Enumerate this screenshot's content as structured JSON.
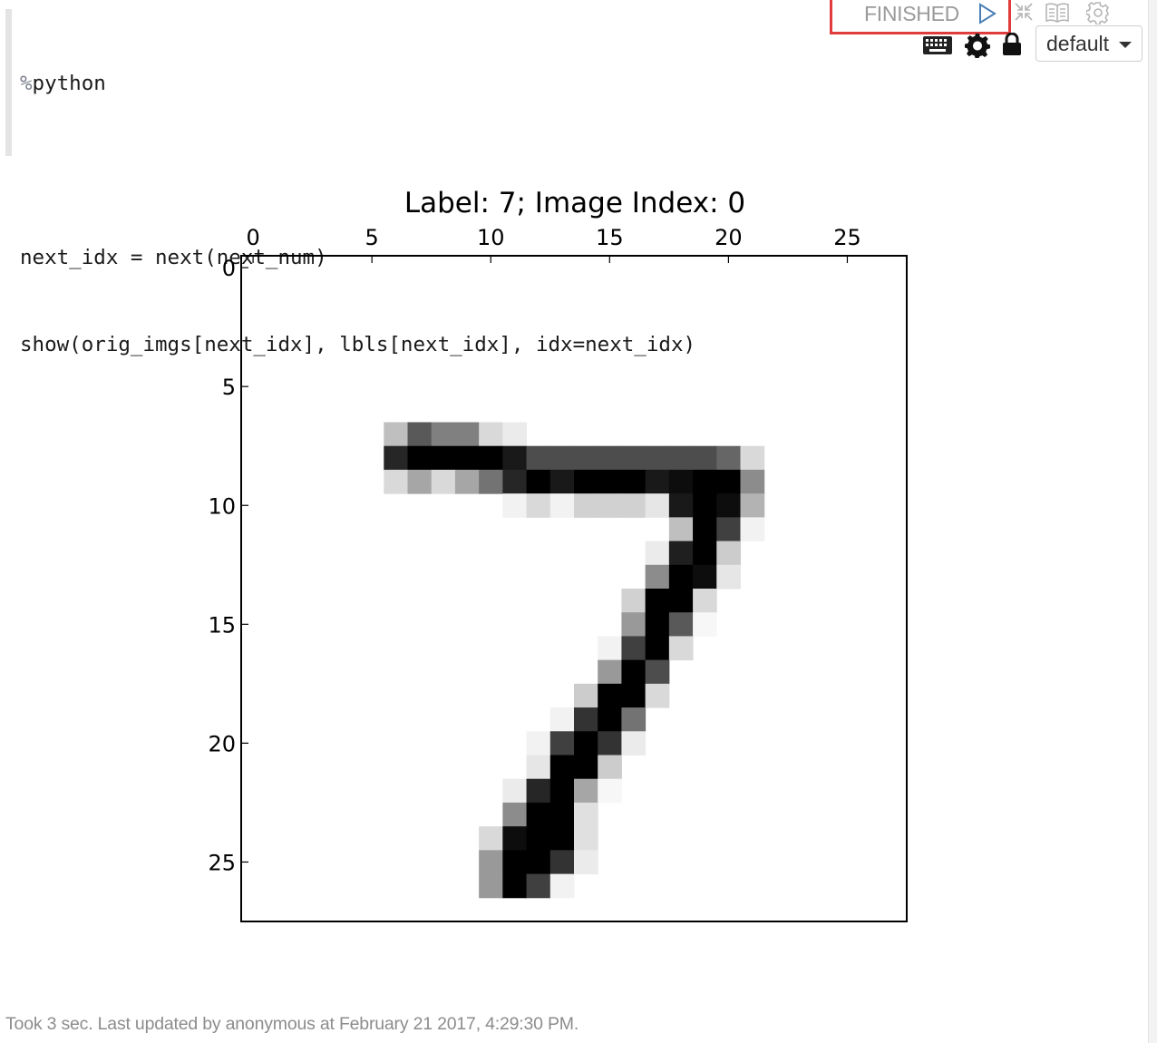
{
  "paragraph": {
    "status": "FINISHED",
    "interpreter_dropdown": "default",
    "code_lines": [
      {
        "prefix": "%",
        "rest": "python"
      },
      {
        "prefix": "",
        "rest": ""
      },
      {
        "prefix": "",
        "rest": "next_idx = next(next_num)"
      },
      {
        "prefix": "",
        "rest": "show(orig_imgs[next_idx], lbls[next_idx], idx=next_idx)"
      }
    ],
    "footer": "Took 3 sec. Last updated by anonymous at February 21 2017, 4:29:30 PM.",
    "icons": {
      "run": "play-outline-icon",
      "collapse": "collapse-arrows-icon",
      "book": "book-icon",
      "settings": "gear-outline-icon",
      "keyboard": "keyboard-icon",
      "paragraph_settings": "gear-solid-icon",
      "lock": "lock-icon"
    },
    "colors": {
      "status_highlight": "#e03c3c",
      "status_text": "#9a9a9a"
    }
  },
  "chart_data": {
    "type": "heatmap",
    "title": "Label: 7; Image Index: 0",
    "colormap": "gray_r",
    "xlim": [
      -0.5,
      27.5
    ],
    "ylim": [
      27.5,
      -0.5
    ],
    "xticks": [
      0,
      5,
      10,
      15,
      20,
      25
    ],
    "yticks": [
      0,
      5,
      10,
      15,
      20,
      25
    ],
    "xaxis_position": "top",
    "grid": false,
    "pixels": [
      [
        7,
        6,
        0.25
      ],
      [
        7,
        7,
        0.65
      ],
      [
        7,
        8,
        0.5
      ],
      [
        7,
        9,
        0.5
      ],
      [
        7,
        10,
        0.15
      ],
      [
        7,
        11,
        0.08
      ],
      [
        8,
        6,
        0.85
      ],
      [
        8,
        7,
        1.0
      ],
      [
        8,
        8,
        1.0
      ],
      [
        8,
        9,
        1.0
      ],
      [
        8,
        10,
        1.0
      ],
      [
        8,
        11,
        0.9
      ],
      [
        8,
        12,
        0.7
      ],
      [
        8,
        13,
        0.7
      ],
      [
        8,
        14,
        0.7
      ],
      [
        8,
        15,
        0.7
      ],
      [
        8,
        16,
        0.7
      ],
      [
        8,
        17,
        0.7
      ],
      [
        8,
        18,
        0.7
      ],
      [
        8,
        19,
        0.7
      ],
      [
        8,
        20,
        0.6
      ],
      [
        8,
        21,
        0.15
      ],
      [
        9,
        6,
        0.15
      ],
      [
        9,
        7,
        0.35
      ],
      [
        9,
        8,
        0.15
      ],
      [
        9,
        9,
        0.35
      ],
      [
        9,
        10,
        0.55
      ],
      [
        9,
        11,
        0.85
      ],
      [
        9,
        12,
        1.0
      ],
      [
        9,
        13,
        0.9
      ],
      [
        9,
        14,
        1.0
      ],
      [
        9,
        15,
        1.0
      ],
      [
        9,
        16,
        1.0
      ],
      [
        9,
        17,
        0.9
      ],
      [
        9,
        18,
        0.95
      ],
      [
        9,
        19,
        1.0
      ],
      [
        9,
        20,
        1.0
      ],
      [
        9,
        21,
        0.45
      ],
      [
        10,
        11,
        0.05
      ],
      [
        10,
        12,
        0.15
      ],
      [
        10,
        13,
        0.05
      ],
      [
        10,
        14,
        0.18
      ],
      [
        10,
        15,
        0.18
      ],
      [
        10,
        16,
        0.18
      ],
      [
        10,
        17,
        0.1
      ],
      [
        10,
        18,
        0.9
      ],
      [
        10,
        19,
        1.0
      ],
      [
        10,
        20,
        0.95
      ],
      [
        10,
        21,
        0.3
      ],
      [
        11,
        18,
        0.25
      ],
      [
        11,
        19,
        1.0
      ],
      [
        11,
        20,
        0.75
      ],
      [
        11,
        21,
        0.05
      ],
      [
        12,
        17,
        0.08
      ],
      [
        12,
        18,
        0.88
      ],
      [
        12,
        19,
        1.0
      ],
      [
        12,
        20,
        0.2
      ],
      [
        13,
        17,
        0.45
      ],
      [
        13,
        18,
        1.0
      ],
      [
        13,
        19,
        0.95
      ],
      [
        13,
        20,
        0.1
      ],
      [
        14,
        16,
        0.18
      ],
      [
        14,
        17,
        1.0
      ],
      [
        14,
        18,
        1.0
      ],
      [
        14,
        19,
        0.15
      ],
      [
        15,
        16,
        0.4
      ],
      [
        15,
        17,
        1.0
      ],
      [
        15,
        18,
        0.65
      ],
      [
        15,
        19,
        0.03
      ],
      [
        16,
        15,
        0.05
      ],
      [
        16,
        16,
        0.75
      ],
      [
        16,
        17,
        1.0
      ],
      [
        16,
        18,
        0.15
      ],
      [
        17,
        15,
        0.4
      ],
      [
        17,
        16,
        1.0
      ],
      [
        17,
        17,
        0.7
      ],
      [
        18,
        14,
        0.2
      ],
      [
        18,
        15,
        1.0
      ],
      [
        18,
        16,
        1.0
      ],
      [
        18,
        17,
        0.15
      ],
      [
        19,
        13,
        0.05
      ],
      [
        19,
        14,
        0.8
      ],
      [
        19,
        15,
        1.0
      ],
      [
        19,
        16,
        0.55
      ],
      [
        20,
        12,
        0.05
      ],
      [
        20,
        13,
        0.75
      ],
      [
        20,
        14,
        1.0
      ],
      [
        20,
        15,
        0.8
      ],
      [
        20,
        16,
        0.08
      ],
      [
        21,
        12,
        0.1
      ],
      [
        21,
        13,
        1.0
      ],
      [
        21,
        14,
        1.0
      ],
      [
        21,
        15,
        0.2
      ],
      [
        22,
        11,
        0.08
      ],
      [
        22,
        12,
        0.85
      ],
      [
        22,
        13,
        1.0
      ],
      [
        22,
        14,
        0.35
      ],
      [
        22,
        15,
        0.03
      ],
      [
        23,
        11,
        0.45
      ],
      [
        23,
        12,
        1.0
      ],
      [
        23,
        13,
        1.0
      ],
      [
        23,
        14,
        0.12
      ],
      [
        24,
        10,
        0.15
      ],
      [
        24,
        11,
        0.95
      ],
      [
        24,
        12,
        1.0
      ],
      [
        24,
        13,
        1.0
      ],
      [
        24,
        14,
        0.12
      ],
      [
        25,
        10,
        0.4
      ],
      [
        25,
        11,
        1.0
      ],
      [
        25,
        12,
        1.0
      ],
      [
        25,
        13,
        0.8
      ],
      [
        25,
        14,
        0.08
      ],
      [
        26,
        10,
        0.4
      ],
      [
        26,
        11,
        1.0
      ],
      [
        26,
        12,
        0.75
      ],
      [
        26,
        13,
        0.05
      ]
    ]
  }
}
